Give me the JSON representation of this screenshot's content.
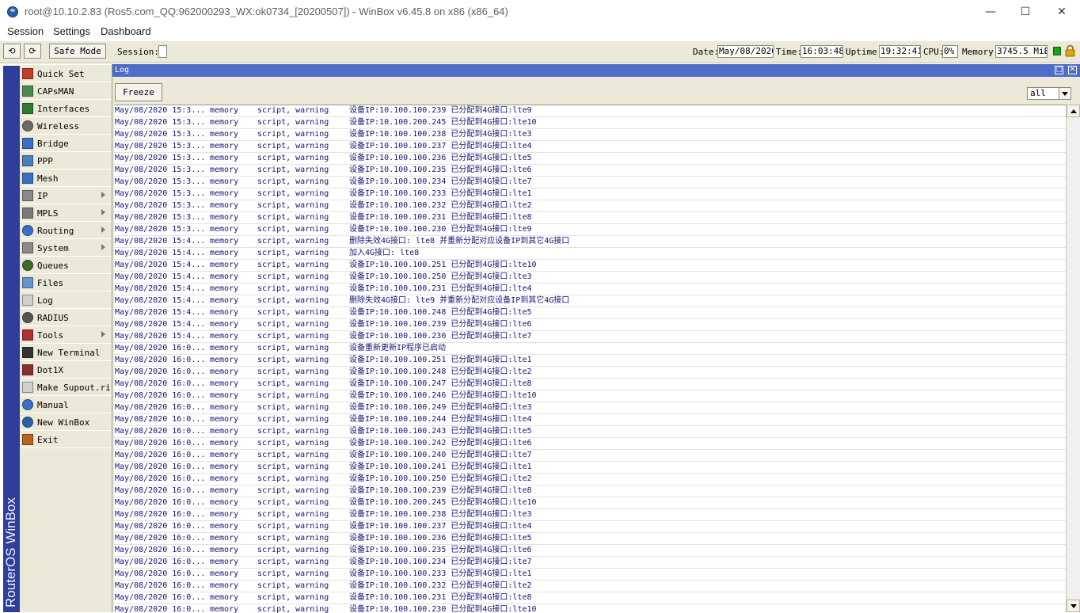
{
  "window": {
    "title": "root@10.10.2.83 (Ros5.com_QQ:962000293_WX:ok0734_[20200507]) - WinBox v6.45.8 on x86 (x86_64)",
    "minimize": "—",
    "maximize": "☐",
    "close": "✕"
  },
  "menu": [
    "Session",
    "Settings",
    "Dashboard"
  ],
  "toolbar": {
    "undo": "⟲",
    "redo": "⟳",
    "safe_mode": "Safe Mode",
    "session_label": "Session:",
    "session_value": "",
    "date_label": "Date:",
    "date_value": "May/08/2020",
    "time_label": "Time:",
    "time_value": "16:03:48",
    "uptime_label": "Uptime:",
    "uptime_value": "19:32:41",
    "cpu_label": "CPU:",
    "cpu_value": "0%",
    "memory_label": "Memory:",
    "memory_value": "3745.5 MiB",
    "status_color": "#19a019",
    "lock_color": "#e0a800"
  },
  "brand": "RouterOS WinBox",
  "sidebar": [
    {
      "label": "Quick Set",
      "icon": "quick-set-icon",
      "submenu": false
    },
    {
      "label": "CAPsMAN",
      "icon": "capsman-icon",
      "submenu": false
    },
    {
      "label": "Interfaces",
      "icon": "interfaces-icon",
      "submenu": false
    },
    {
      "label": "Wireless",
      "icon": "wireless-icon",
      "submenu": false
    },
    {
      "label": "Bridge",
      "icon": "bridge-icon",
      "submenu": false
    },
    {
      "label": "PPP",
      "icon": "ppp-icon",
      "submenu": false
    },
    {
      "label": "Mesh",
      "icon": "mesh-icon",
      "submenu": false
    },
    {
      "label": "IP",
      "icon": "ip-icon",
      "submenu": true
    },
    {
      "label": "MPLS",
      "icon": "mpls-icon",
      "submenu": true
    },
    {
      "label": "Routing",
      "icon": "routing-icon",
      "submenu": true
    },
    {
      "label": "System",
      "icon": "system-icon",
      "submenu": true
    },
    {
      "label": "Queues",
      "icon": "queues-icon",
      "submenu": false
    },
    {
      "label": "Files",
      "icon": "files-icon",
      "submenu": false
    },
    {
      "label": "Log",
      "icon": "log-icon",
      "submenu": false
    },
    {
      "label": "RADIUS",
      "icon": "radius-icon",
      "submenu": false
    },
    {
      "label": "Tools",
      "icon": "tools-icon",
      "submenu": true
    },
    {
      "label": "New Terminal",
      "icon": "terminal-icon",
      "submenu": false
    },
    {
      "label": "Dot1X",
      "icon": "dot1x-icon",
      "submenu": false
    },
    {
      "label": "Make Supout.rif",
      "icon": "supout-icon",
      "submenu": false
    },
    {
      "label": "Manual",
      "icon": "manual-icon",
      "submenu": false
    },
    {
      "label": "New WinBox",
      "icon": "winbox-icon",
      "submenu": false
    },
    {
      "label": "Exit",
      "icon": "exit-icon",
      "submenu": false
    }
  ],
  "log": {
    "title": "Log",
    "freeze": "Freeze",
    "filter": "all",
    "rows": [
      [
        "May/08/2020 15:3...",
        "memory",
        "script, warning",
        "设备IP:10.100.100.239 已分配到4G接口:lte9"
      ],
      [
        "May/08/2020 15:3...",
        "memory",
        "script, warning",
        "设备IP:10.100.200.245 已分配到4G接口:lte10"
      ],
      [
        "May/08/2020 15:3...",
        "memory",
        "script, warning",
        "设备IP:10.100.100.238 已分配到4G接口:lte3"
      ],
      [
        "May/08/2020 15:3...",
        "memory",
        "script, warning",
        "设备IP:10.100.100.237 已分配到4G接口:lte4"
      ],
      [
        "May/08/2020 15:3...",
        "memory",
        "script, warning",
        "设备IP:10.100.100.236 已分配到4G接口:lte5"
      ],
      [
        "May/08/2020 15:3...",
        "memory",
        "script, warning",
        "设备IP:10.100.100.235 已分配到4G接口:lte6"
      ],
      [
        "May/08/2020 15:3...",
        "memory",
        "script, warning",
        "设备IP:10.100.100.234 已分配到4G接口:lte7"
      ],
      [
        "May/08/2020 15:3...",
        "memory",
        "script, warning",
        "设备IP:10.100.100.233 已分配到4G接口:lte1"
      ],
      [
        "May/08/2020 15:3...",
        "memory",
        "script, warning",
        "设备IP:10.100.100.232 已分配到4G接口:lte2"
      ],
      [
        "May/08/2020 15:3...",
        "memory",
        "script, warning",
        "设备IP:10.100.100.231 已分配到4G接口:lte8"
      ],
      [
        "May/08/2020 15:3...",
        "memory",
        "script, warning",
        "设备IP:10.100.100.230 已分配到4G接口:lte9"
      ],
      [
        "May/08/2020 15:4...",
        "memory",
        "script, warning",
        "删除失效4G接口: lte8 并重新分配对应设备IP到其它4G接口"
      ],
      [
        "May/08/2020 15:4...",
        "memory",
        "script, warning",
        "加入4G接口: lte8"
      ],
      [
        "May/08/2020 15:4...",
        "memory",
        "script, warning",
        "设备IP:10.100.100.251 已分配到4G接口:lte10"
      ],
      [
        "May/08/2020 15:4...",
        "memory",
        "script, warning",
        "设备IP:10.100.100.250 已分配到4G接口:lte3"
      ],
      [
        "May/08/2020 15:4...",
        "memory",
        "script, warning",
        "设备IP:10.100.100.231 已分配到4G接口:lte4"
      ],
      [
        "May/08/2020 15:4...",
        "memory",
        "script, warning",
        "删除失效4G接口: lte9 并重新分配对应设备IP到其它4G接口"
      ],
      [
        "May/08/2020 15:4...",
        "memory",
        "script, warning",
        "设备IP:10.100.100.248 已分配到4G接口:lte5"
      ],
      [
        "May/08/2020 15:4...",
        "memory",
        "script, warning",
        "设备IP:10.100.100.239 已分配到4G接口:lte6"
      ],
      [
        "May/08/2020 15:4...",
        "memory",
        "script, warning",
        "设备IP:10.100.100.230 已分配到4G接口:lte7"
      ],
      [
        "May/08/2020 16:0...",
        "memory",
        "script, warning",
        "设备重新更新IP程序已启动"
      ],
      [
        "May/08/2020 16:0...",
        "memory",
        "script, warning",
        "设备IP:10.100.100.251 已分配到4G接口:lte1"
      ],
      [
        "May/08/2020 16:0...",
        "memory",
        "script, warning",
        "设备IP:10.100.100.248 已分配到4G接口:lte2"
      ],
      [
        "May/08/2020 16:0...",
        "memory",
        "script, warning",
        "设备IP:10.100.100.247 已分配到4G接口:lte8"
      ],
      [
        "May/08/2020 16:0...",
        "memory",
        "script, warning",
        "设备IP:10.100.100.246 已分配到4G接口:lte10"
      ],
      [
        "May/08/2020 16:0...",
        "memory",
        "script, warning",
        "设备IP:10.100.100.249 已分配到4G接口:lte3"
      ],
      [
        "May/08/2020 16:0...",
        "memory",
        "script, warning",
        "设备IP:10.100.100.244 已分配到4G接口:lte4"
      ],
      [
        "May/08/2020 16:0...",
        "memory",
        "script, warning",
        "设备IP:10.100.100.243 已分配到4G接口:lte5"
      ],
      [
        "May/08/2020 16:0...",
        "memory",
        "script, warning",
        "设备IP:10.100.100.242 已分配到4G接口:lte6"
      ],
      [
        "May/08/2020 16:0...",
        "memory",
        "script, warning",
        "设备IP:10.100.100.240 已分配到4G接口:lte7"
      ],
      [
        "May/08/2020 16:0...",
        "memory",
        "script, warning",
        "设备IP:10.100.100.241 已分配到4G接口:lte1"
      ],
      [
        "May/08/2020 16:0...",
        "memory",
        "script, warning",
        "设备IP:10.100.100.250 已分配到4G接口:lte2"
      ],
      [
        "May/08/2020 16:0...",
        "memory",
        "script, warning",
        "设备IP:10.100.100.239 已分配到4G接口:lte8"
      ],
      [
        "May/08/2020 16:0...",
        "memory",
        "script, warning",
        "设备IP:10.100.200.245 已分配到4G接口:lte10"
      ],
      [
        "May/08/2020 16:0...",
        "memory",
        "script, warning",
        "设备IP:10.100.100.238 已分配到4G接口:lte3"
      ],
      [
        "May/08/2020 16:0...",
        "memory",
        "script, warning",
        "设备IP:10.100.100.237 已分配到4G接口:lte4"
      ],
      [
        "May/08/2020 16:0...",
        "memory",
        "script, warning",
        "设备IP:10.100.100.236 已分配到4G接口:lte5"
      ],
      [
        "May/08/2020 16:0...",
        "memory",
        "script, warning",
        "设备IP:10.100.100.235 已分配到4G接口:lte6"
      ],
      [
        "May/08/2020 16:0...",
        "memory",
        "script, warning",
        "设备IP:10.100.100.234 已分配到4G接口:lte7"
      ],
      [
        "May/08/2020 16:0...",
        "memory",
        "script, warning",
        "设备IP:10.100.100.233 已分配到4G接口:lte1"
      ],
      [
        "May/08/2020 16:0...",
        "memory",
        "script, warning",
        "设备IP:10.100.100.232 已分配到4G接口:lte2"
      ],
      [
        "May/08/2020 16:0...",
        "memory",
        "script, warning",
        "设备IP:10.100.100.231 已分配到4G接口:lte8"
      ],
      [
        "May/08/2020 16:0...",
        "memory",
        "script, warning",
        "设备IP:10.100.100.230 已分配到4G接口:lte10"
      ]
    ]
  }
}
